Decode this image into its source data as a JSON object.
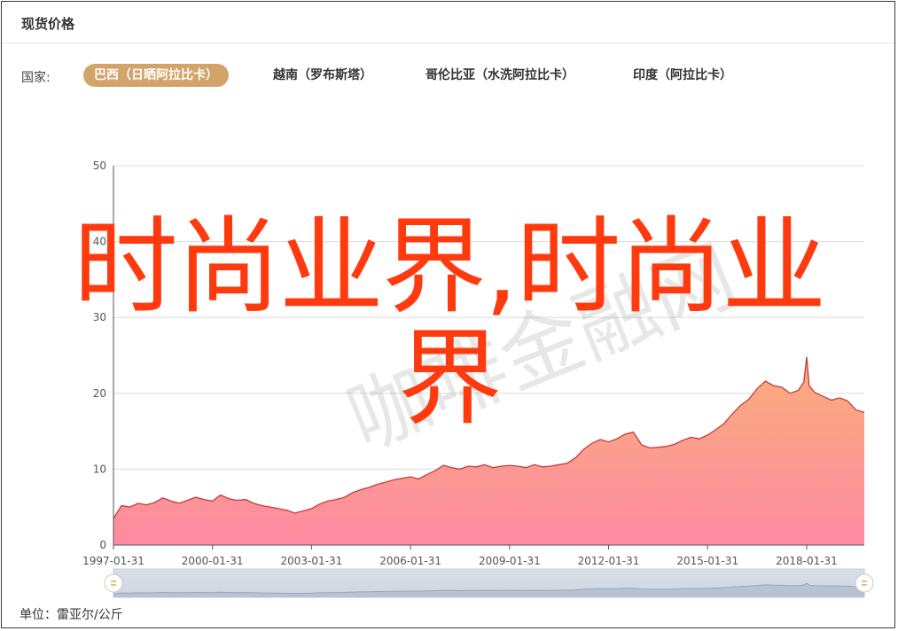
{
  "panel": {
    "title": "现货价格"
  },
  "countries": {
    "label": "国家:",
    "tabs": [
      {
        "label": "巴西（日晒阿拉比卡）",
        "active": true
      },
      {
        "label": "越南（罗布斯塔）",
        "active": false
      },
      {
        "label": "哥伦比亚（水洗阿拉比卡）",
        "active": false
      },
      {
        "label": "印度（阿拉比卡）",
        "active": false
      }
    ]
  },
  "unit": "单位：雷亚尔/公斤",
  "overlay": {
    "line1": "时尚业界,时尚业",
    "line2": "界"
  },
  "watermark": "咖啡金融网",
  "colors": {
    "accent": "#d2a469",
    "area_top": "#fbae7b",
    "area_bottom": "#fd8aa2",
    "line": "#c43d3d",
    "overlay": "#ff3a0e"
  },
  "chart_data": {
    "type": "area",
    "title": "",
    "xlabel": "",
    "ylabel": "",
    "ylim": [
      0,
      50
    ],
    "yticks": [
      "0",
      "10",
      "20",
      "30",
      "40",
      "50"
    ],
    "xticks": [
      "1997-01-31",
      "2000-01-31",
      "2003-01-31",
      "2006-01-31",
      "2009-01-31",
      "2012-01-31",
      "2015-01-31",
      "2018-01-31"
    ],
    "grid": true,
    "legend": "none",
    "series": [
      {
        "x": [
          "1997-01-31",
          "1997-04-30",
          "1997-07-31",
          "1997-10-31",
          "1998-01-31",
          "1998-04-30",
          "1998-07-31",
          "1998-10-31",
          "1999-01-31",
          "1999-04-30",
          "1999-07-31",
          "1999-10-31",
          "2000-01-31",
          "2000-04-30",
          "2000-07-31",
          "2000-10-31",
          "2001-01-31",
          "2001-04-30",
          "2001-07-31",
          "2001-10-31",
          "2002-01-31",
          "2002-04-30",
          "2002-07-31",
          "2002-10-31",
          "2003-01-31",
          "2003-04-30",
          "2003-07-31",
          "2003-10-31",
          "2004-01-31",
          "2004-04-30",
          "2004-07-31",
          "2004-10-31",
          "2005-01-31",
          "2005-04-30",
          "2005-07-31",
          "2005-10-31",
          "2006-01-31",
          "2006-04-30",
          "2006-07-31",
          "2006-10-31",
          "2007-01-31",
          "2007-04-30",
          "2007-07-31",
          "2007-10-31",
          "2008-01-31",
          "2008-04-30",
          "2008-07-31",
          "2008-10-31",
          "2009-01-31",
          "2009-04-30",
          "2009-07-31",
          "2009-10-31",
          "2010-01-31",
          "2010-04-30",
          "2010-07-31",
          "2010-10-31",
          "2011-01-31",
          "2011-04-30",
          "2011-07-31",
          "2011-10-31",
          "2012-01-31",
          "2012-04-30",
          "2012-07-31",
          "2012-10-31",
          "2013-01-31",
          "2013-04-30",
          "2013-07-31",
          "2013-10-31",
          "2014-01-31",
          "2014-04-30",
          "2014-07-31",
          "2014-10-31",
          "2015-01-31",
          "2015-04-30",
          "2015-07-31",
          "2015-10-31",
          "2016-01-31",
          "2016-04-30",
          "2016-07-31",
          "2016-10-31",
          "2017-01-31",
          "2017-04-30",
          "2017-07-31",
          "2017-10-31",
          "2017-12-31",
          "2018-01-31",
          "2018-02-28",
          "2018-04-30",
          "2018-07-31",
          "2018-10-31",
          "2019-01-31",
          "2019-04-30",
          "2019-07-31",
          "2019-10-31"
        ],
        "y": [
          3.5,
          5.2,
          5.0,
          5.5,
          5.3,
          5.6,
          6.2,
          5.8,
          5.5,
          5.9,
          6.3,
          6.0,
          5.8,
          6.6,
          6.1,
          5.9,
          6.0,
          5.5,
          5.2,
          5.0,
          4.8,
          4.6,
          4.2,
          4.5,
          4.8,
          5.4,
          5.8,
          6.0,
          6.3,
          6.9,
          7.3,
          7.6,
          8.0,
          8.3,
          8.6,
          8.8,
          9.0,
          8.7,
          9.3,
          9.8,
          10.5,
          10.2,
          10.0,
          10.4,
          10.3,
          10.6,
          10.2,
          10.4,
          10.5,
          10.4,
          10.2,
          10.6,
          10.3,
          10.4,
          10.6,
          10.8,
          11.5,
          12.6,
          13.4,
          13.9,
          13.6,
          14.0,
          14.6,
          14.9,
          13.2,
          12.8,
          12.9,
          13.0,
          13.3,
          13.8,
          14.2,
          14.0,
          14.5,
          15.2,
          16.0,
          17.3,
          18.4,
          19.2,
          20.6,
          21.6,
          21.0,
          20.8,
          20.0,
          20.4,
          21.5,
          24.8,
          21.0,
          20.1,
          19.6,
          19.1,
          19.4,
          19.0,
          17.8,
          17.5
        ]
      }
    ]
  }
}
